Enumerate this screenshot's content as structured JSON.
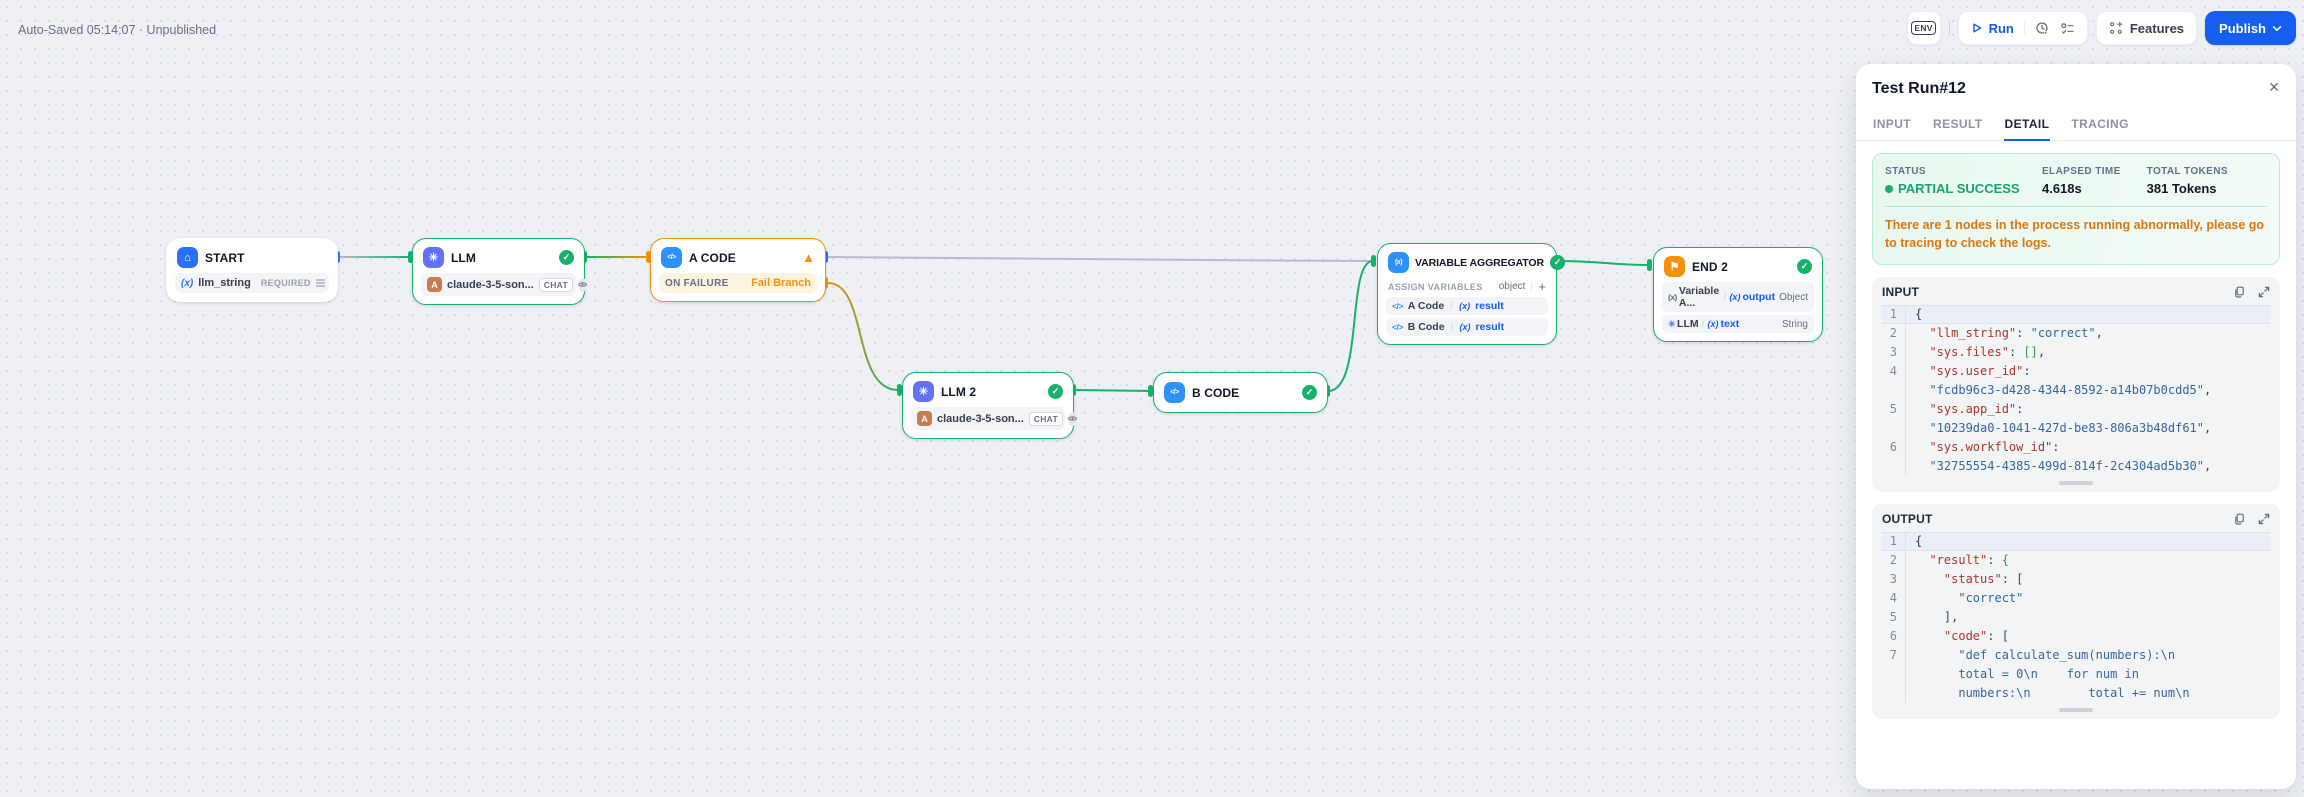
{
  "colors": {
    "accent_blue": "#155eef",
    "success_green": "#17b26a",
    "warning_orange": "#f79009",
    "status_card_bg": "#e9f8f0",
    "code_key": "#a8372e",
    "code_string": "#36689c",
    "code_bracket_green": "#2f9e44"
  },
  "topbar": {
    "autosave": "Auto-Saved 05:14:07 · Unpublished",
    "env_label": "ENV",
    "run_label": "Run",
    "features_label": "Features",
    "publish_label": "Publish"
  },
  "canvas": {
    "nodes": {
      "start": {
        "title": "START",
        "variable": "llm_string",
        "required": "REQUIRED"
      },
      "llm": {
        "title": "LLM",
        "model": "claude-3-5-son...",
        "badge": "CHAT"
      },
      "a_code": {
        "title": "A CODE",
        "fail_label": "ON FAILURE",
        "fail_value": "Fail Branch"
      },
      "llm_2": {
        "title": "LLM 2",
        "model": "claude-3-5-son...",
        "badge": "CHAT"
      },
      "b_code": {
        "title": "B CODE"
      },
      "aggregator": {
        "title": "VARIABLE AGGREGATOR",
        "section": "ASSIGN VARIABLES",
        "type": "object",
        "plus": "+",
        "rows": [
          {
            "source": "A Code",
            "variable": "result"
          },
          {
            "source": "B Code",
            "variable": "result"
          }
        ]
      },
      "end_2": {
        "title": "END 2",
        "rows": [
          {
            "source": "Variable A...",
            "variable": "output",
            "type": "Object"
          },
          {
            "source": "LLM",
            "variable": "text",
            "type": "String"
          }
        ]
      }
    }
  },
  "panel": {
    "title": "Test Run#12",
    "close_glyph": "✕",
    "tabs": [
      "INPUT",
      "RESULT",
      "DETAIL",
      "TRACING"
    ],
    "active_tab": "DETAIL",
    "status_card": {
      "status_label": "STATUS",
      "status_value": "PARTIAL SUCCESS",
      "elapsed_label": "ELAPSED TIME",
      "elapsed_value": "4.618s",
      "tokens_label": "TOTAL TOKENS",
      "tokens_value": "381 Tokens",
      "warning": "There are 1 nodes in the process running abnormally, please go to tracing to check the logs."
    },
    "input_block": {
      "title": "INPUT",
      "lines": [
        {
          "n": "1",
          "hl": true,
          "segs": [
            {
              "t": "{",
              "c": "brace"
            }
          ]
        },
        {
          "n": "2",
          "segs": [
            {
              "t": "  "
            },
            {
              "t": "\"llm_string\"",
              "c": "key"
            },
            {
              "t": ": ",
              "c": "pun"
            },
            {
              "t": "\"correct\"",
              "c": "str"
            },
            {
              "t": ",",
              "c": "pun"
            }
          ]
        },
        {
          "n": "3",
          "segs": [
            {
              "t": "  "
            },
            {
              "t": "\"sys.files\"",
              "c": "key"
            },
            {
              "t": ": ",
              "c": "pun"
            },
            {
              "t": "[]",
              "c": "grn"
            },
            {
              "t": ",",
              "c": "pun"
            }
          ]
        },
        {
          "n": "4",
          "segs": [
            {
              "t": "  "
            },
            {
              "t": "\"sys.user_id\"",
              "c": "key"
            },
            {
              "t": ":",
              "c": "pun"
            }
          ]
        },
        {
          "n": "",
          "segs": [
            {
              "t": "  "
            },
            {
              "t": "\"fcdb96c3-d428-4344-8592-a14b07b0cdd5\"",
              "c": "str"
            },
            {
              "t": ",",
              "c": "pun"
            }
          ]
        },
        {
          "n": "5",
          "segs": [
            {
              "t": "  "
            },
            {
              "t": "\"sys.app_id\"",
              "c": "key"
            },
            {
              "t": ":",
              "c": "pun"
            }
          ]
        },
        {
          "n": "",
          "segs": [
            {
              "t": "  "
            },
            {
              "t": "\"10239da0-1041-427d-be83-806a3b48df61\"",
              "c": "str"
            },
            {
              "t": ",",
              "c": "pun"
            }
          ]
        },
        {
          "n": "6",
          "segs": [
            {
              "t": "  "
            },
            {
              "t": "\"sys.workflow_id\"",
              "c": "key"
            },
            {
              "t": ":",
              "c": "pun"
            }
          ]
        },
        {
          "n": "",
          "segs": [
            {
              "t": "  "
            },
            {
              "t": "\"32755554-4385-499d-814f-2c4304ad5b30\"",
              "c": "str"
            },
            {
              "t": ",",
              "c": "pun"
            }
          ]
        }
      ]
    },
    "output_block": {
      "title": "OUTPUT",
      "lines": [
        {
          "n": "1",
          "hl": true,
          "segs": [
            {
              "t": "{",
              "c": "brace"
            }
          ]
        },
        {
          "n": "2",
          "segs": [
            {
              "t": "  "
            },
            {
              "t": "\"result\"",
              "c": "key"
            },
            {
              "t": ": ",
              "c": "pun"
            },
            {
              "t": "{",
              "c": "grn"
            }
          ]
        },
        {
          "n": "3",
          "segs": [
            {
              "t": "    "
            },
            {
              "t": "\"status\"",
              "c": "key"
            },
            {
              "t": ": ",
              "c": "pun"
            },
            {
              "t": "[",
              "c": "pun"
            }
          ]
        },
        {
          "n": "4",
          "segs": [
            {
              "t": "      "
            },
            {
              "t": "\"correct\"",
              "c": "str"
            }
          ]
        },
        {
          "n": "5",
          "segs": [
            {
              "t": "    "
            },
            {
              "t": "],",
              "c": "pun"
            }
          ]
        },
        {
          "n": "6",
          "segs": [
            {
              "t": "    "
            },
            {
              "t": "\"code\"",
              "c": "key"
            },
            {
              "t": ": ",
              "c": "pun"
            },
            {
              "t": "[",
              "c": "pun"
            }
          ]
        },
        {
          "n": "7",
          "segs": [
            {
              "t": "      "
            },
            {
              "t": "\"def calculate_sum(numbers):\\n",
              "c": "str"
            }
          ]
        },
        {
          "n": "",
          "segs": [
            {
              "t": "      "
            },
            {
              "t": "total = 0\\n    for num in",
              "c": "str"
            }
          ]
        },
        {
          "n": "",
          "segs": [
            {
              "t": "      "
            },
            {
              "t": "numbers:\\n        total += num\\n",
              "c": "str"
            }
          ]
        }
      ]
    }
  },
  "icons": {
    "var_glyph": "(x)",
    "code_glyph": "</>",
    "home_glyph": "⌂",
    "llm_glyph": "✳",
    "end_glyph": "⚑",
    "anthropic_glyph": "A"
  }
}
